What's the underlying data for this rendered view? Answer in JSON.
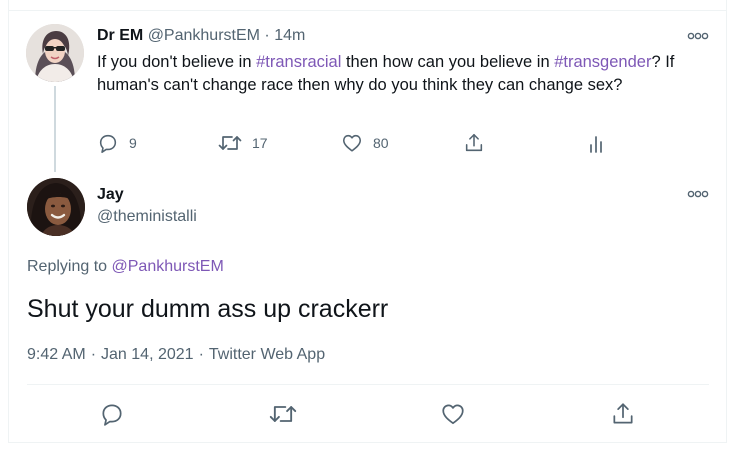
{
  "parent_tweet": {
    "display_name": "Dr EM",
    "handle": "@PankhurstEM",
    "separator": "·",
    "time_ago": "14m",
    "text_parts": {
      "p1": "If you don't believe in ",
      "hashtag1": "#transracial",
      "p2": " then how can you believe in ",
      "hashtag2": "#transgender",
      "p3": "? If human's can't change race then why do you think they can change sex?"
    },
    "counts": {
      "replies": "9",
      "retweets": "17",
      "likes": "80"
    },
    "icons": [
      "reply-icon",
      "retweet-icon",
      "like-icon",
      "share-icon",
      "analytics-icon",
      "more-icon"
    ]
  },
  "reply_tweet": {
    "display_name": "Jay",
    "handle": "@theministalli",
    "replying_to_label": "Replying to ",
    "replying_to_handle": "@PankhurstEM",
    "text": "Shut your dumm ass up crackerr",
    "time": "9:42 AM",
    "date": "Jan 14, 2021",
    "meta_separator": "·",
    "source": "Twitter Web App",
    "icons": [
      "reply-icon",
      "retweet-icon",
      "like-icon",
      "share-icon",
      "more-icon"
    ]
  },
  "colors": {
    "text_primary": "#0f1419",
    "text_secondary": "#536471",
    "link_accent": "#7e58b6",
    "divider": "#eff3f4"
  }
}
